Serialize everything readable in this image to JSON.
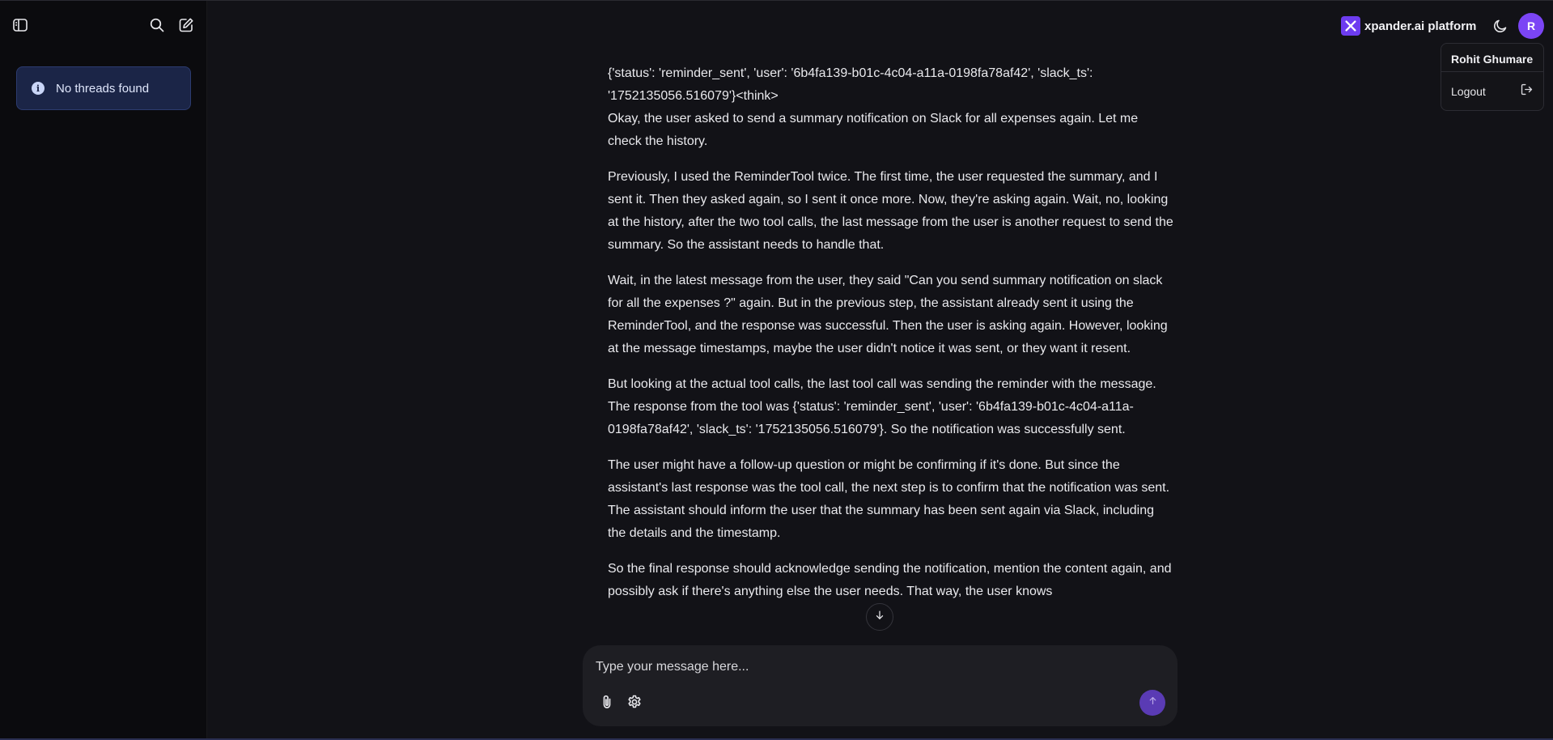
{
  "sidebar": {
    "empty_notice": "No threads found",
    "icons": [
      "sidebar-toggle-icon",
      "search-icon",
      "new-chat-icon",
      "info-icon"
    ]
  },
  "header": {
    "brand_name": "xpander.ai platform",
    "avatar_initial": "R",
    "user_menu": {
      "user_name": "Rohit Ghumare",
      "logout_label": "Logout"
    }
  },
  "message": {
    "paragraphs": [
      "{'status': 'reminder_sent', 'user': '6b4fa139-b01c-4c04-a11a-0198fa78af42', 'slack_ts': '1752135056.516079'}<think>\nOkay, the user asked to send a summary notification on Slack for all expenses again. Let me check the history.",
      "Previously, I used the ReminderTool twice. The first time, the user requested the summary, and I sent it. Then they asked again, so I sent it once more. Now, they're asking again. Wait, no, looking at the history, after the two tool calls, the last message from the user is another request to send the summary. So the assistant needs to handle that.",
      "Wait, in the latest message from the user, they said \"Can you send summary notification on slack for all the expenses ?\" again. But in the previous step, the assistant already sent it using the ReminderTool, and the response was successful. Then the user is asking again. However, looking at the message timestamps, maybe the user didn't notice it was sent, or they want it resent.",
      "But looking at the actual tool calls, the last tool call was sending the reminder with the message. The response from the tool was {'status': 'reminder_sent', 'user': '6b4fa139-b01c-4c04-a11a-0198fa78af42', 'slack_ts': '1752135056.516079'}. So the notification was successfully sent.",
      "The user might have a follow-up question or might be confirming if it's done. But since the assistant's last response was the tool call, the next step is to confirm that the notification was sent. The assistant should inform the user that the summary has been sent again via Slack, including the details and the timestamp.",
      "So the final response should acknowledge sending the notification, mention the content again, and possibly ask if there's anything else the user needs. That way, the user knows"
    ]
  },
  "composer": {
    "placeholder": "Type your message here..."
  },
  "colors": {
    "background": "#121217",
    "sidebar": "#0b0b0e",
    "accent": "#7b45f5",
    "notice_bg": "#1b2547"
  }
}
